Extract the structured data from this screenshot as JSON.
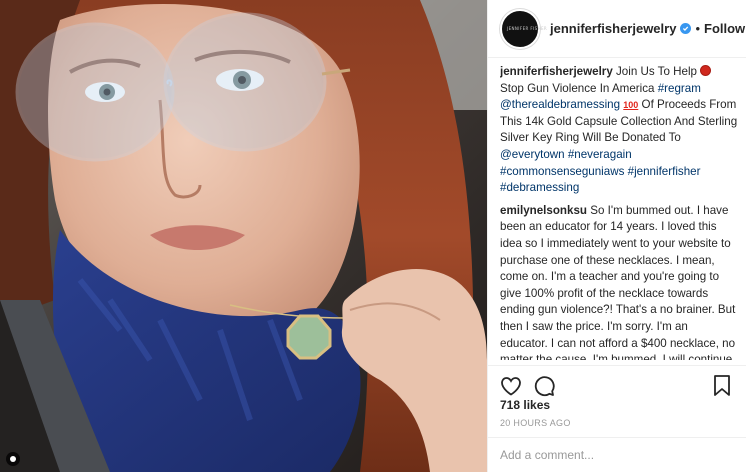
{
  "account": {
    "username": "jenniferfisherjewelry",
    "avatar_text": "JENNIFER FISHER",
    "follow_status": "Following",
    "separator": "•"
  },
  "caption": {
    "username": "jenniferfisherjewelry",
    "part1": "Join Us To Help",
    "part2": "Stop Gun Violence In America",
    "tag_regram": "#regram",
    "mention_debra": "@therealdebramessing",
    "part3": "Of Proceeds From This 14k Gold Capsule Collection And Sterling Silver Key Ring Will Be Donated To",
    "mention_everytown": "@everytown",
    "tag_neveragain": "#neveragain",
    "tag_commonsense": "#commonsenseguniaws",
    "tag_jenniferfisher": "#jenniferfisher",
    "tag_debramessing": "#debramessing",
    "emoji_100": "100"
  },
  "comment1": {
    "username": "emilynelsonksu",
    "text": "So I'm bummed out. I have been an educator for 14 years. I loved this idea so I immediately went to your website to purchase one of these necklaces. I mean, come on. I'm a teacher and you're going to give 100% profit of the necklace towards ending gun violence?! That's a no brainer. But then I saw the price. I'm sorry. I'm an educator. I can not afford a $400 necklace, no matter the cause. I'm bummed. I will continue to donate on my own."
  },
  "icons": [
    "heart-icon",
    "comment-icon",
    "bookmark-icon",
    "verified-badge-icon"
  ],
  "likes": "718 likes",
  "timestamp": "20 HOURS AGO",
  "add_comment": {
    "placeholder": "Add a comment..."
  },
  "colors": {
    "link": "#003569",
    "verified": "#3897f0",
    "meta": "#999999",
    "border": "#efefef"
  }
}
